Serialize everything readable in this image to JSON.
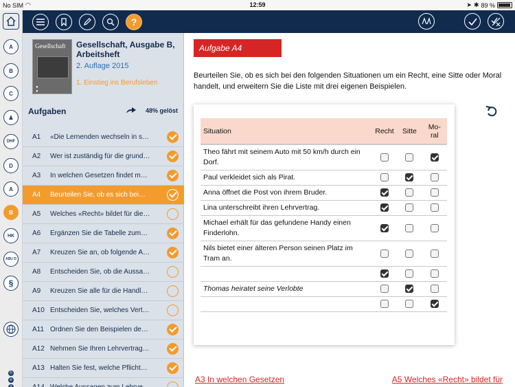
{
  "status_bar": {
    "carrier": "No SIM",
    "time": "12:59",
    "battery": "89 %"
  },
  "rail": {
    "items": [
      {
        "icon": "home-icon",
        "label": ""
      },
      {
        "icon": "person-a-icon",
        "label": "A"
      },
      {
        "icon": "person-b-icon",
        "label": "B"
      },
      {
        "icon": "person-c-icon",
        "label": "C"
      },
      {
        "icon": "person-bar-icon",
        "label": ""
      },
      {
        "icon": "dhf-icon",
        "label": "DHF"
      },
      {
        "icon": "cart-d-icon",
        "label": "D"
      },
      {
        "icon": "person-a2-icon",
        "label": "A"
      },
      {
        "icon": "person-b-active-icon",
        "label": "B"
      },
      {
        "icon": "hk-icon",
        "label": "HK"
      },
      {
        "icon": "abu-d-icon",
        "label": "ABU D"
      },
      {
        "icon": "paragraph-icon",
        "label": "§"
      },
      {
        "icon": "globe-icon",
        "label": ""
      }
    ],
    "logo_letters": [
      "h",
      "e",
      "p"
    ]
  },
  "book": {
    "cover_title": "Gesellschaft",
    "title": "Gesellschaft, Ausgabe B, Arbeitsheft",
    "edition": "2. Auflage 2015",
    "chapter": "1. Einstieg ins Berufsleben"
  },
  "tasks_header": {
    "title": "Aufgaben",
    "progress": "48% gelöst"
  },
  "tasks": [
    {
      "id": "A1",
      "text": "«Die Lernenden wechseln in s…",
      "done": true,
      "selected": false
    },
    {
      "id": "A2",
      "text": "Wer ist zuständig für die grund…",
      "done": true,
      "selected": false
    },
    {
      "id": "A3",
      "text": "In welchen Gesetzen findet m…",
      "done": true,
      "selected": false
    },
    {
      "id": "A4",
      "text": "Beurteilen Sie, ob es sich bei…",
      "done": true,
      "selected": true
    },
    {
      "id": "A5",
      "text": "Welches «Recht» bildet für die…",
      "done": false,
      "selected": false
    },
    {
      "id": "A6",
      "text": "Ergänzen Sie die Tabelle zum…",
      "done": true,
      "selected": false
    },
    {
      "id": "A7",
      "text": "Kreuzen Sie an, ob folgende A…",
      "done": true,
      "selected": false
    },
    {
      "id": "A8",
      "text": "Entscheiden Sie, ob die Aussa…",
      "done": false,
      "selected": false
    },
    {
      "id": "A9",
      "text": "Kreuzen Sie alle für die Handl…",
      "done": false,
      "selected": false
    },
    {
      "id": "A10",
      "text": "Entscheiden Sie, welches Vert…",
      "done": false,
      "selected": false
    },
    {
      "id": "A11",
      "text": "Ordnen Sie den Beispielen de…",
      "done": true,
      "selected": false
    },
    {
      "id": "A12",
      "text": "Nehmen Sie Ihren Lehrvertrag…",
      "done": true,
      "selected": false
    },
    {
      "id": "A13",
      "text": "Halten Sie fest, welche Pflicht…",
      "done": true,
      "selected": false
    },
    {
      "id": "A14",
      "text": "Welche Aussagen zum Lehrve…",
      "done": false,
      "selected": false
    }
  ],
  "content": {
    "badge": "Aufgabe A4",
    "instruction": "Beurteilen Sie, ob es sich bei den folgenden Situationen um ein Recht, eine Sitte oder Moral handelt, und erweitern Sie die Liste mit drei eigenen Beispielen.",
    "table": {
      "headers": {
        "situation": "Situation",
        "recht": "Recht",
        "sitte": "Sitte",
        "moral": "Mo-\nral"
      },
      "rows": [
        {
          "text": "Theo fährt mit seinem Auto mit 50 km/h durch ein Dorf.",
          "italic": false,
          "checks": [
            false,
            false,
            true
          ]
        },
        {
          "text": "Paul verkleidet sich als Pirat.",
          "italic": false,
          "checks": [
            false,
            true,
            false
          ]
        },
        {
          "text": "Anna öffnet die Post von ihrem Bruder.",
          "italic": false,
          "checks": [
            true,
            false,
            false
          ]
        },
        {
          "text": "Lina unterschreibt ihren Lehrvertrag.",
          "italic": false,
          "checks": [
            true,
            false,
            false
          ]
        },
        {
          "text": "Michael erhält für das gefundene Handy einen Finderlohn.",
          "italic": false,
          "checks": [
            true,
            false,
            false
          ]
        },
        {
          "text": "Nils bietet einer älteren Person seinen Platz im Tram an.",
          "italic": false,
          "checks": [
            false,
            false,
            false
          ]
        },
        {
          "text": "",
          "italic": false,
          "checks": [
            true,
            false,
            false
          ]
        },
        {
          "text": "Thomas heiratet seine Verlobte",
          "italic": true,
          "checks": [
            false,
            true,
            false
          ]
        },
        {
          "text": "",
          "italic": false,
          "checks": [
            false,
            false,
            true
          ]
        }
      ]
    },
    "prev_link": "A3 In welchen Gesetzen",
    "next_link": "A5 Welches «Recht» bildet für"
  }
}
